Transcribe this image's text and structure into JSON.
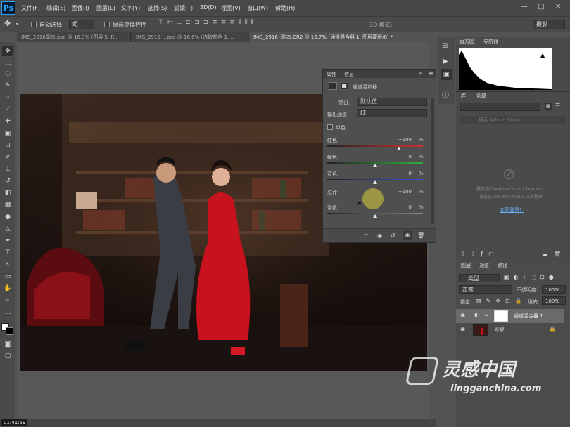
{
  "app": {
    "logo": "Ps"
  },
  "menu": [
    "文件(F)",
    "编辑(E)",
    "图像(I)",
    "图层(L)",
    "文字(Y)",
    "选择(S)",
    "滤镜(T)",
    "3D(D)",
    "视图(V)",
    "窗口(W)",
    "帮助(H)"
  ],
  "window_controls": [
    "—",
    "□",
    "✕"
  ],
  "options": {
    "auto_select_label": "自动选择:",
    "auto_select_value": "组",
    "show_transform_label": "显示变换控件",
    "mode_3d_label": "3D 模式:",
    "workspace_value": "摄影"
  },
  "tabs": [
    {
      "label": "IMG_2916副本.psd @ 16.3% (图层 5, R..."
    },
    {
      "label": "IMG_2916-...psd @ 16.6% (选取颜色 1, ..."
    },
    {
      "label": "IMG_2916--副本.CR2 @ 16.7% (通道混合器 1, 图层蒙版/8) *"
    }
  ],
  "properties_panel": {
    "tab_properties": "属性",
    "tab_info": "信息",
    "title": "通道混和器",
    "preset_label": "预设:",
    "preset_value": "默认值",
    "output_label": "输出通道:",
    "output_value": "红",
    "mono_label": "单色",
    "sliders": [
      {
        "label": "红色:",
        "value": "+100",
        "unit": "%",
        "level": 100,
        "color": "#d23030"
      },
      {
        "label": "绿色:",
        "value": "0",
        "unit": "%",
        "level": 0,
        "color": "#2fb03c"
      },
      {
        "label": "蓝色:",
        "value": "0",
        "unit": "%",
        "level": 0,
        "color": "#3a4fd8"
      },
      {
        "label": "总计:",
        "value": "+100",
        "unit": "%",
        "level": 100,
        "color": null
      },
      {
        "label": "常数:",
        "value": "0",
        "unit": "%",
        "level": 0,
        "color": "#888888"
      }
    ]
  },
  "histogram_panel": {
    "tab_histogram": "直方图",
    "tab_navigator": "导航器",
    "warning": "▲"
  },
  "library_panel": {
    "tab_library": "库",
    "tab_adjust": "调整",
    "search_placeholder": "搜索 Adobe Stock",
    "cc_msg_1": "要使用 Creative Cloud Libraries，",
    "cc_msg_2": "请安装 Creative Cloud 应用程序",
    "login_link": "立即登录！"
  },
  "layers_panel": {
    "tab_layers": "图层",
    "tab_channels": "通道",
    "tab_paths": "路径",
    "kind_value": "类型",
    "blend_value": "正常",
    "opacity_label": "不透明度:",
    "opacity_value": "100%",
    "lock_label": "锁定:",
    "fill_label": "填充:",
    "fill_value": "100%",
    "layers": [
      {
        "name": "通道混合器 1",
        "selected": true
      },
      {
        "name": "背景",
        "selected": false
      }
    ]
  },
  "status": {
    "time": "01:41:59"
  },
  "watermark": {
    "brand_cn": "灵感中国",
    "brand_url": "lingganchina.com"
  }
}
